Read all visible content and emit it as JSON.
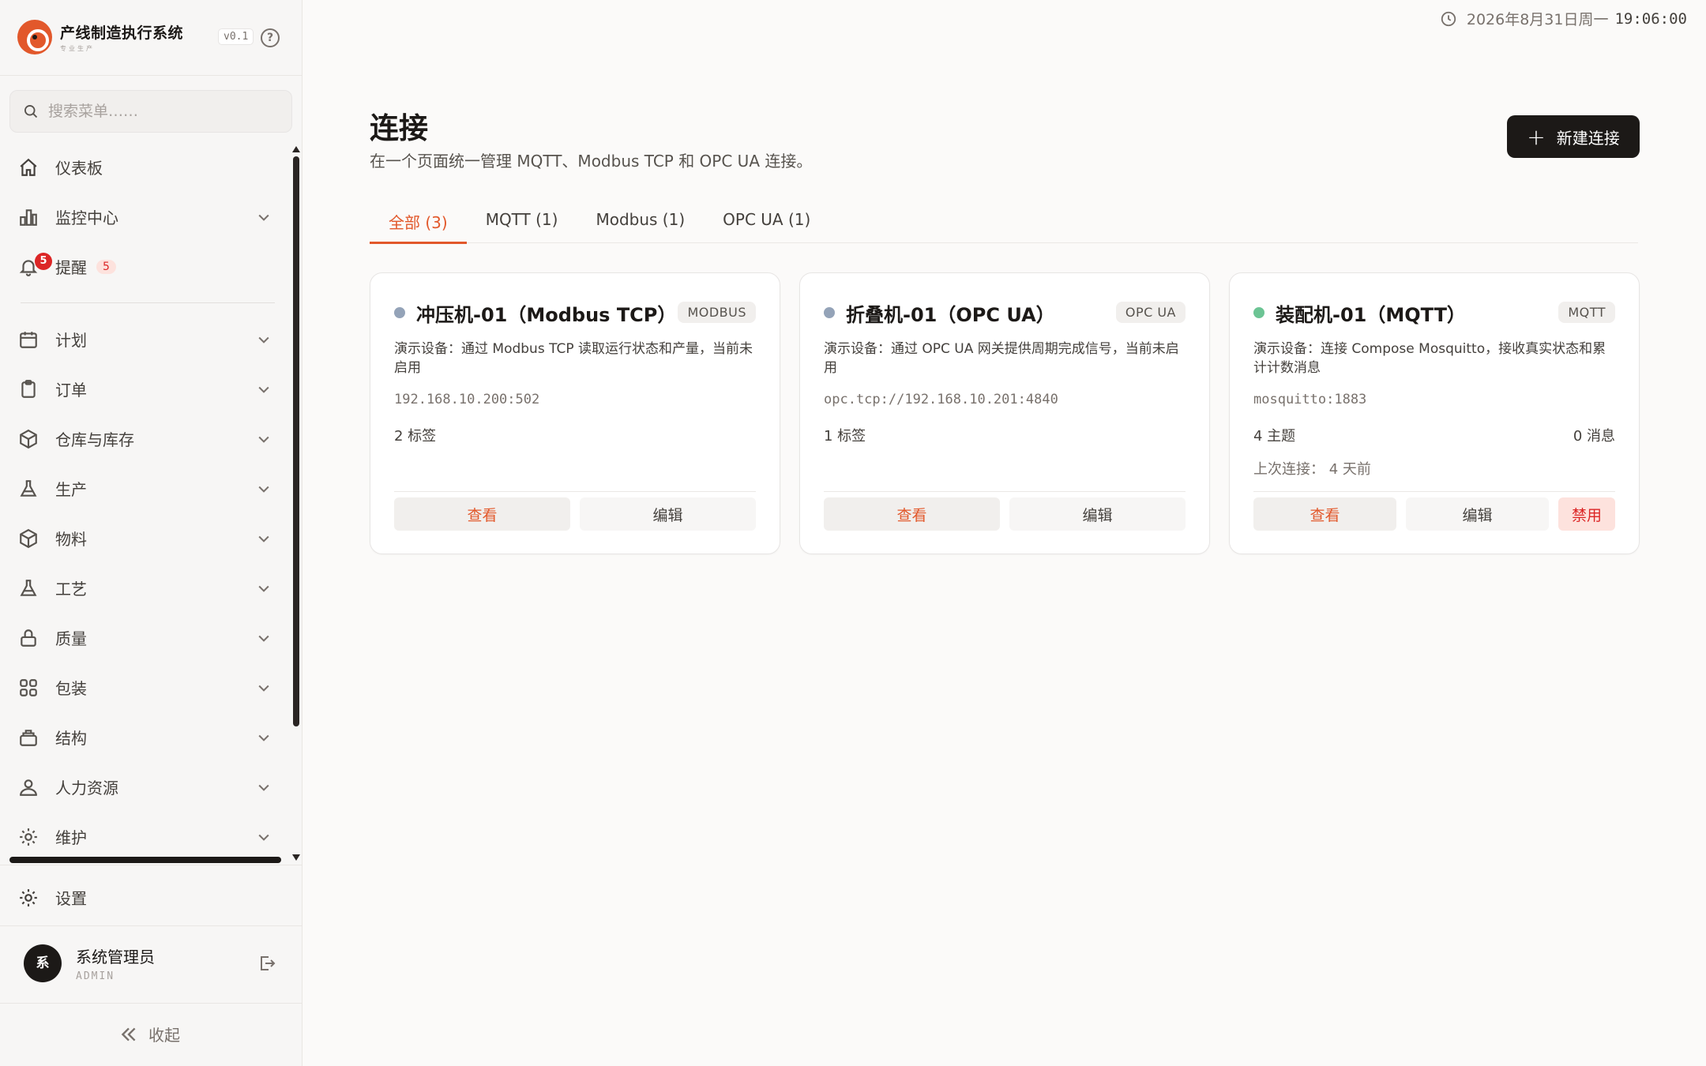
{
  "app": {
    "title": "产线制造执行系统",
    "subtitle": "专业生产",
    "version": "v0.1",
    "help_glyph": "?"
  },
  "search": {
    "placeholder": "搜索菜单……"
  },
  "nav": {
    "dashboard": "仪表板",
    "monitor": "监控中心",
    "alerts": "提醒",
    "alerts_badge": "5",
    "alerts_count": "5",
    "plan": "计划",
    "orders": "订单",
    "warehouse": "仓库与库存",
    "production": "生产",
    "materials": "物料",
    "process": "工艺",
    "quality": "质量",
    "packaging": "包装",
    "structure": "结构",
    "hr": "人力资源",
    "maintenance": "维护",
    "settings": "设置"
  },
  "user": {
    "initial": "系",
    "name": "系统管理员",
    "role": "ADMIN"
  },
  "collapse_label": "收起",
  "topbar": {
    "date": "2026年8月31日周一",
    "time": "19:06:00"
  },
  "page": {
    "title": "连接",
    "subtitle": "在一个页面统一管理 MQTT、Modbus TCP 和 OPC UA 连接。",
    "new_button": "新建连接"
  },
  "tabs": [
    {
      "label": "全部 (3)"
    },
    {
      "label": "MQTT (1)"
    },
    {
      "label": "Modbus (1)"
    },
    {
      "label": "OPC UA (1)"
    }
  ],
  "colors": {
    "accent": "#e2582b",
    "status_offline": "#94a3b8",
    "status_online": "#6cc494",
    "danger": "#dc2626"
  },
  "cards": [
    {
      "title": "冲压机-01（Modbus TCP）",
      "badge": "MODBUS",
      "description": "演示设备：通过 Modbus TCP 读取运行状态和产量，当前未启用",
      "address": "192.168.10.200:502",
      "tags": "2 标签",
      "view": "查看",
      "edit": "编辑"
    },
    {
      "title": "折叠机-01（OPC UA）",
      "badge": "OPC UA",
      "description": "演示设备：通过 OPC UA 网关提供周期完成信号，当前未启用",
      "address": "opc.tcp://192.168.10.201:4840",
      "tags": "1 标签",
      "view": "查看",
      "edit": "编辑"
    },
    {
      "title": "装配机-01（MQTT）",
      "badge": "MQTT",
      "description": "演示设备：连接 Compose Mosquitto，接收真实状态和累计计数消息",
      "address": "mosquitto:1883",
      "topics": "4 主题",
      "messages": "0 消息",
      "last_connected": "上次连接： 4 天前",
      "view": "查看",
      "edit": "编辑",
      "disable": "禁用"
    }
  ]
}
